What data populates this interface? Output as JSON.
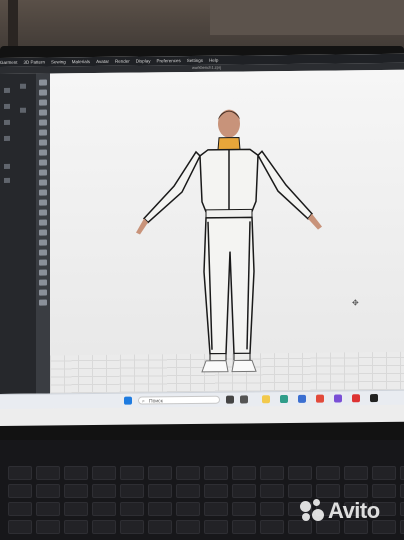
{
  "menu": {
    "items": [
      "Garment",
      "3D Pattern",
      "Sewing",
      "Materials",
      "Avatar",
      "Render",
      "Display",
      "Preferences",
      "Settings",
      "Help"
    ]
  },
  "titlebar": {
    "filename": "workbench1.zprj"
  },
  "taskbar": {
    "search_placeholder": "Поиск"
  },
  "watermark": {
    "brand": "Avito"
  },
  "colors": {
    "suit": "#f4f4f2",
    "collar": "#e8a63a",
    "piping": "#1a1a1a",
    "viewport": "#eeeeee"
  }
}
